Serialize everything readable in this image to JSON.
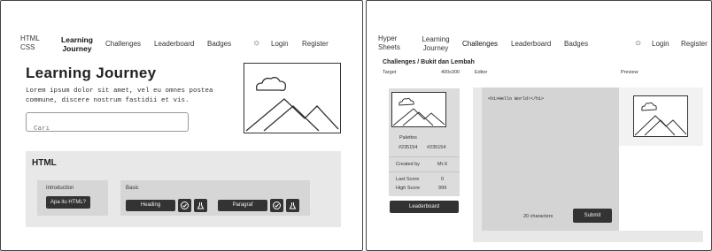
{
  "left": {
    "nav": {
      "logo": [
        "HTML",
        "CSS"
      ],
      "learning_journey": [
        "Learning",
        "Journey"
      ],
      "challenges": "Challenges",
      "leaderboard": "Leaderboard",
      "badges": "Badges",
      "login": "Login",
      "register": "Register"
    },
    "hero": {
      "title": "Learning Journey",
      "text_line1": "Lorem ipsum dolor sit amet, vel eu omnes postea",
      "text_line2": "commune, discere nostrum fastidii et vis."
    },
    "search": {
      "placeholder": "Cari"
    },
    "section": {
      "title": "HTML",
      "intro_label": "Introduction",
      "intro_button": "Apa itu HTML?",
      "basic_label": "Basic",
      "heading_button": "Heading",
      "paragraf_button": "Paragraf"
    }
  },
  "right": {
    "nav": {
      "logo": [
        "Hyper",
        "Sheets"
      ],
      "learning_journey": [
        "Learning",
        "Journey"
      ],
      "challenges": "Challenges",
      "leaderboard": "Leaderboard",
      "badges": "Badges",
      "login": "Login",
      "register": "Register"
    },
    "breadcrumb": "Challenges / Bukit dan Lembah",
    "target_label": "Target",
    "target_size": "400x300",
    "editor_label": "Editor",
    "preview_label": "Preview",
    "palettes_label": "Palettes",
    "palette_colors": [
      "#235154",
      "#235154"
    ],
    "created_by_label": "Created by",
    "created_by_value": "Mr.X",
    "last_score_label": "Last Score",
    "last_score_value": "0",
    "high_score_label": "High Score",
    "high_score_value": "999",
    "leaderboard_button": "Leaderboard",
    "code": "<h1>Hello World!</h1>",
    "char_count": "20 characters",
    "submit_button": "Submit"
  }
}
